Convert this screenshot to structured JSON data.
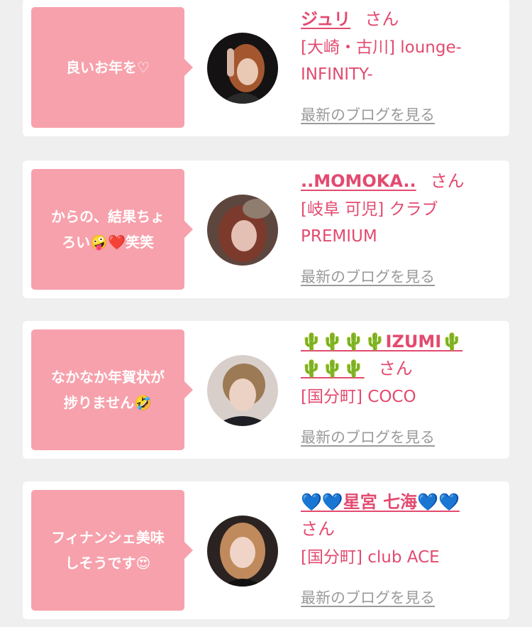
{
  "entries": [
    {
      "message": "良いお年を♡",
      "name": "ジュリ",
      "suffix": "さん",
      "shop": "[大崎・古川] lounge-\nINFINITY-",
      "link": "最新のブログを見る"
    },
    {
      "message": "からの、結果ちょ\nろい🤪❤️笑笑",
      "name": "..MOMOKA..",
      "suffix": "さん",
      "shop": "[岐阜 可児] クラブ\nPREMIUM",
      "link": "最新のブログを見る"
    },
    {
      "message": "なかなか年賀状が\n捗りません🤣",
      "name": "🌵🌵🌵🌵IZUMI🌵\n🌵🌵🌵",
      "suffix": "さん",
      "shop": "[国分町] COCO",
      "link": "最新のブログを見る"
    },
    {
      "message": "フィナンシェ美味\nしそうです😍",
      "name": "💙💙星宮 七海💙💙",
      "suffix": "さん",
      "shop": "[国分町] club ACE",
      "link": "最新のブログを見る"
    }
  ]
}
